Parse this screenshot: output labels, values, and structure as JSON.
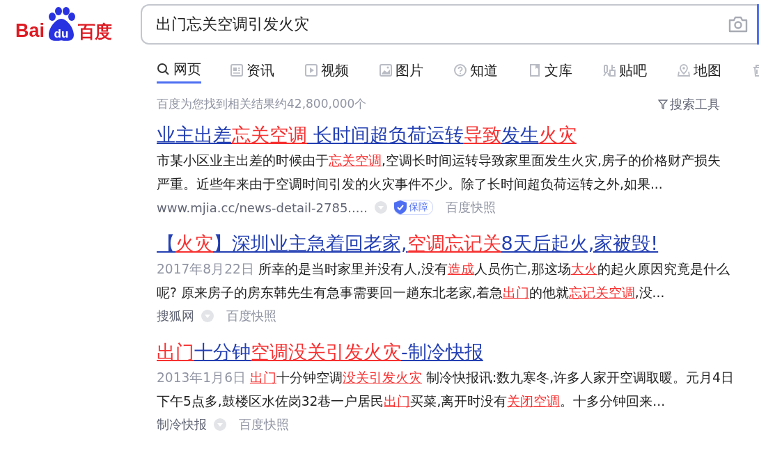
{
  "logo": {
    "left": "Bai",
    "paw": "du",
    "right": "百度"
  },
  "search": {
    "value": "出门忘关空调引发火灾"
  },
  "tabs": [
    {
      "label": "网页",
      "selected": true
    },
    {
      "label": "资讯",
      "selected": false
    },
    {
      "label": "视频",
      "selected": false
    },
    {
      "label": "图片",
      "selected": false
    },
    {
      "label": "知道",
      "selected": false
    },
    {
      "label": "文库",
      "selected": false
    },
    {
      "label": "贴吧",
      "selected": false
    },
    {
      "label": "地图",
      "selected": false
    }
  ],
  "result_count": "百度为您找到相关结果约42,800,000个",
  "search_tools": "搜索工具",
  "results": [
    {
      "title": [
        {
          "text": "业主出差",
          "hl": false
        },
        {
          "text": "忘关空调",
          "hl": true
        },
        {
          "text": " 长时间超负荷运转",
          "hl": false
        },
        {
          "text": "导致",
          "hl": true
        },
        {
          "text": "发生",
          "hl": false
        },
        {
          "text": "火灾",
          "hl": true
        }
      ],
      "lines": [
        [
          {
            "text": "市某小区业主出差的时候由于",
            "hl": false
          },
          {
            "text": "忘关空调",
            "hl": true
          },
          {
            "text": ",空调长时间运转导致家里面发生火灾,房子的价格财产损失",
            "hl": false
          }
        ],
        [
          {
            "text": "严重。近些年来由于空调时间引发的火灾事件不少。除了长时间超负荷运转之外,如果...",
            "hl": false
          }
        ]
      ],
      "source": "www.mjia.cc/news-detail-2785.....",
      "badge": "保障",
      "snapshot": "百度快照"
    },
    {
      "title": [
        {
          "text": "【",
          "hl": false
        },
        {
          "text": "火灾",
          "hl": true
        },
        {
          "text": "】深圳业主急着回老家,",
          "hl": false
        },
        {
          "text": "空调忘记关",
          "hl": true
        },
        {
          "text": "8天后起火,家被毁!",
          "hl": false
        }
      ],
      "date": "2017年8月22日",
      "lines": [
        [
          {
            "text": "所幸的是当时家里并没有人,没有",
            "hl": false
          },
          {
            "text": "造成",
            "hl": true
          },
          {
            "text": "人员伤亡,那这场",
            "hl": false
          },
          {
            "text": "大火",
            "hl": true
          },
          {
            "text": "的起火原因究竟是什么",
            "hl": false
          }
        ],
        [
          {
            "text": "呢? 原来房子的房东韩先生有急事需要回一趟东北老家,着急",
            "hl": false
          },
          {
            "text": "出门",
            "hl": true
          },
          {
            "text": "的他就",
            "hl": false
          },
          {
            "text": "忘记关空调",
            "hl": true
          },
          {
            "text": ",没...",
            "hl": false
          }
        ]
      ],
      "source": "搜狐网",
      "snapshot": "百度快照"
    },
    {
      "title": [
        {
          "text": "出门",
          "hl": true
        },
        {
          "text": "十分钟",
          "hl": false
        },
        {
          "text": "空调没关引发火灾",
          "hl": true
        },
        {
          "text": "-制冷快报",
          "hl": false
        }
      ],
      "date": "2013年1月6日",
      "lines": [
        [
          {
            "text": "出门",
            "hl": true
          },
          {
            "text": "十分钟空调",
            "hl": false
          },
          {
            "text": "没关引发火灾",
            "hl": true
          },
          {
            "text": " 制冷快报讯:数九寒冬,许多人家开空调取暖。元月4日",
            "hl": false
          }
        ],
        [
          {
            "text": "下午5点多,鼓楼区水佐岗32巷一户居民",
            "hl": false
          },
          {
            "text": "出门",
            "hl": true
          },
          {
            "text": "买菜,离开时没有",
            "hl": false
          },
          {
            "text": "关闭空调",
            "hl": true
          },
          {
            "text": "。十多分钟回来...",
            "hl": false
          }
        ]
      ],
      "source": "制冷快报",
      "snapshot": "百度快照"
    }
  ]
}
